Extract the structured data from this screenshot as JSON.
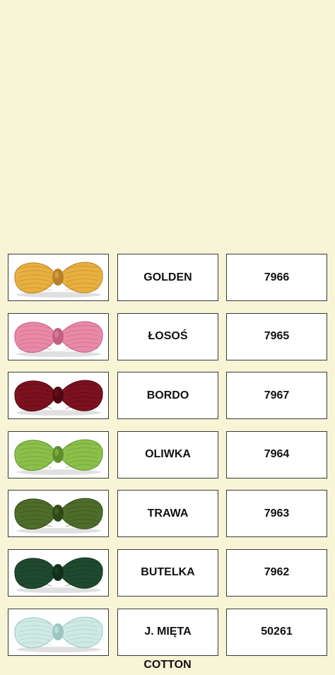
{
  "items": [
    {
      "name": "GOLDEN",
      "code": "7966",
      "color": "#e7b03f",
      "shade": "#b9822a",
      "swatch_icon": "yarn-skein-golden-icon"
    },
    {
      "name": "ŁOSOŚ",
      "code": "7965",
      "color": "#e88aa7",
      "shade": "#c25f84",
      "swatch_icon": "yarn-skein-salmon-icon"
    },
    {
      "name": "BORDO",
      "code": "7967",
      "color": "#7d1120",
      "shade": "#4f0912",
      "swatch_icon": "yarn-skein-burgundy-icon"
    },
    {
      "name": "OLIWKA",
      "code": "7964",
      "color": "#8cc04a",
      "shade": "#5f8f2d",
      "swatch_icon": "yarn-skein-olive-icon"
    },
    {
      "name": "TRAWA",
      "code": "7963",
      "color": "#4f6d2a",
      "shade": "#314818",
      "swatch_icon": "yarn-skein-grass-icon"
    },
    {
      "name": "BUTELKA",
      "code": "7962",
      "color": "#1f4a30",
      "shade": "#10301d",
      "swatch_icon": "yarn-skein-bottle-icon"
    },
    {
      "name": "J. MIĘTA",
      "code": "50261",
      "color": "#cfe9e4",
      "shade": "#9ec6c1",
      "swatch_icon": "yarn-skein-mint-icon"
    }
  ],
  "footer": {
    "label": "COTTON"
  }
}
